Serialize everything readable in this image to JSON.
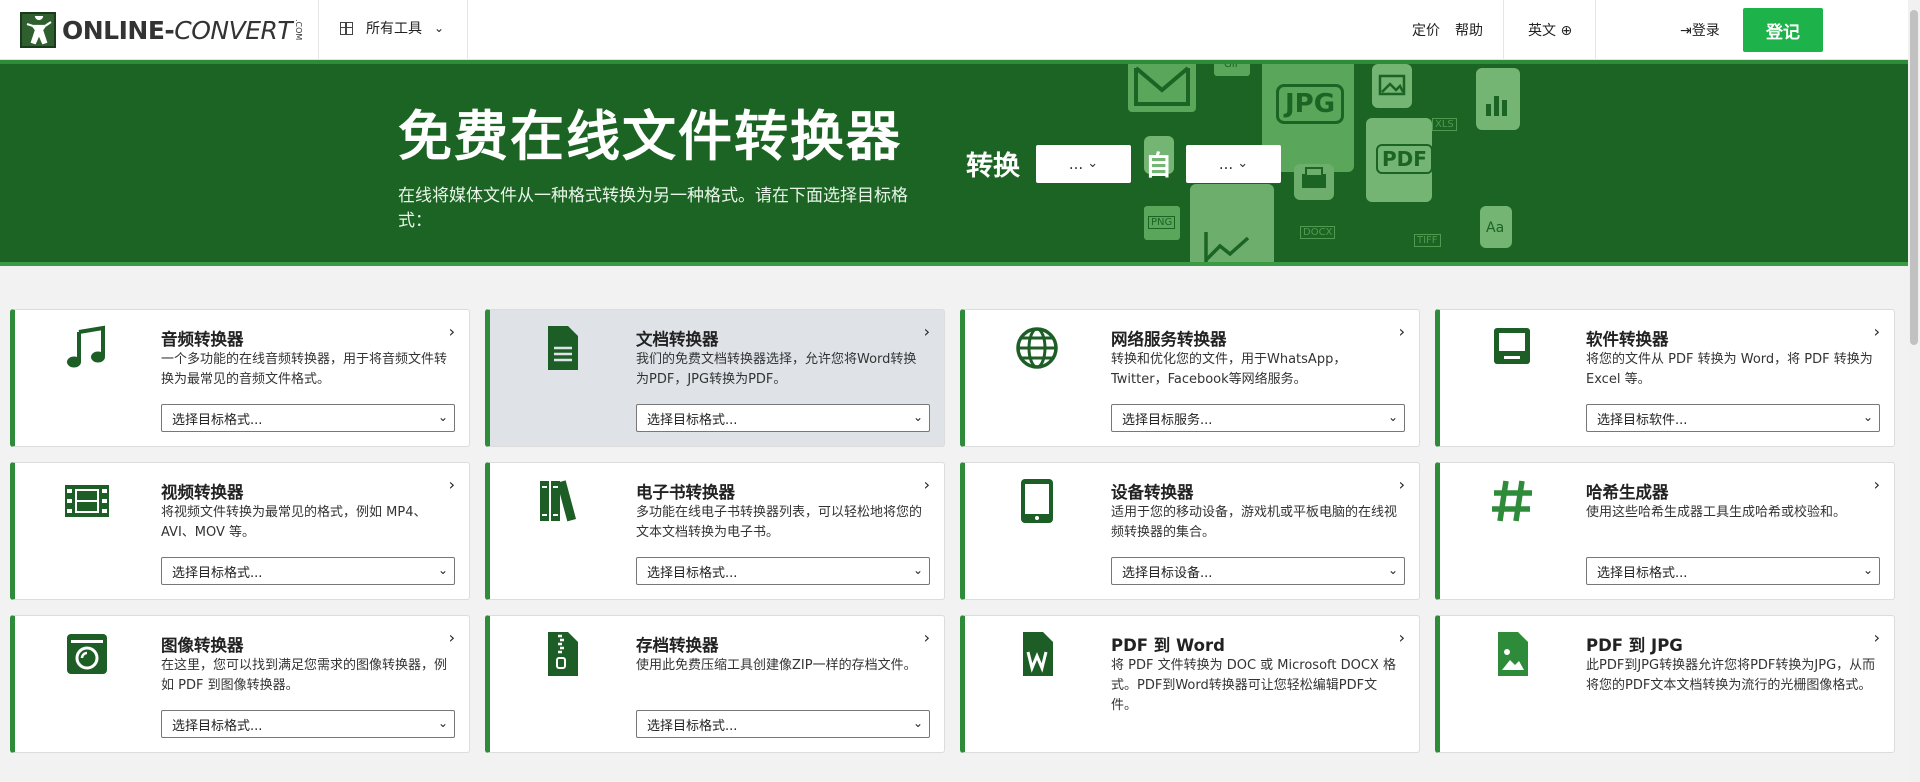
{
  "header": {
    "logo_main": "ONLINE-",
    "logo_conv": "CONVERT",
    "logo_com": ".COM",
    "all_tools": "所有工具",
    "pricing": "定价",
    "help": "帮助",
    "language": "英文",
    "login": "登录",
    "signup": "登记"
  },
  "hero": {
    "title": "免费在线文件转换器",
    "subtitle": "在线将媒体文件从一种格式转换为另一种格式。请在下面选择目标格式：",
    "convert_label": "转换",
    "from_label": "自",
    "select_to": "...",
    "select_from": "...",
    "deco": {
      "jpg": "JPG",
      "pdf": "PDF",
      "xls": "XLS",
      "png": "PNG",
      "docx": "DOCX",
      "tiff": "TIFF",
      "gif": "GIF",
      "aa": "Aa"
    }
  },
  "cards": [
    {
      "title": "音频转换器",
      "desc": "一个多功能的在线音频转换器，用于将音频文件转换为最常见的音频文件格式。",
      "select": "选择目标格式...",
      "icon": "music-note-icon"
    },
    {
      "title": "文档转换器",
      "desc": "我们的免费文档转换器选择，允许您将Word转换为PDF，JPG转换为PDF。",
      "select": "选择目标格式...",
      "icon": "document-icon"
    },
    {
      "title": "网络服务转换器",
      "desc": "转换和优化您的文件，用于WhatsApp，Twitter，Facebook等网络服务。",
      "select": "选择目标服务...",
      "icon": "globe-icon"
    },
    {
      "title": "软件转换器",
      "desc": "将您的文件从 PDF 转换为 Word，将 PDF 转换为 Excel 等。",
      "select": "选择目标软件...",
      "icon": "monitor-icon"
    },
    {
      "title": "视频转换器",
      "desc": "将视频文件转换为最常见的格式，例如 MP4、AVI、MOV 等。",
      "select": "选择目标格式...",
      "icon": "film-icon"
    },
    {
      "title": "电子书转换器",
      "desc": "多功能在线电子书转换器列表，可以轻松地将您的文本文档转换为电子书。",
      "select": "选择目标格式...",
      "icon": "books-icon"
    },
    {
      "title": "设备转换器",
      "desc": "适用于您的移动设备，游戏机或平板电脑的在线视频转换器的集合。",
      "select": "选择目标设备...",
      "icon": "tablet-icon"
    },
    {
      "title": "哈希生成器",
      "desc": "使用这些哈希生成器工具生成哈希或校验和。",
      "select": "选择目标格式...",
      "icon": "hash-icon"
    },
    {
      "title": "图像转换器",
      "desc": "在这里，您可以找到满足您需求的图像转换器，例如 PDF 到图像转换器。",
      "select": "选择目标格式...",
      "icon": "camera-icon"
    },
    {
      "title": "存档转换器",
      "desc": "使用此免费压缩工具创建像ZIP一样的存档文件。",
      "select": "选择目标格式...",
      "icon": "zip-file-icon"
    },
    {
      "title": "PDF 到 Word",
      "desc": "将 PDF 文件转换为 DOC 或 Microsoft DOCX 格式。PDF到Word转换器可让您轻松编辑PDF文件。",
      "select": "",
      "icon": "word-file-icon"
    },
    {
      "title": "PDF 到 JPG",
      "desc": "此PDF到JPG转换器允许您将PDF转换为JPG，从而将您的PDF文本文档转换为流行的光栅图像格式。",
      "select": "",
      "icon": "image-file-icon"
    }
  ]
}
